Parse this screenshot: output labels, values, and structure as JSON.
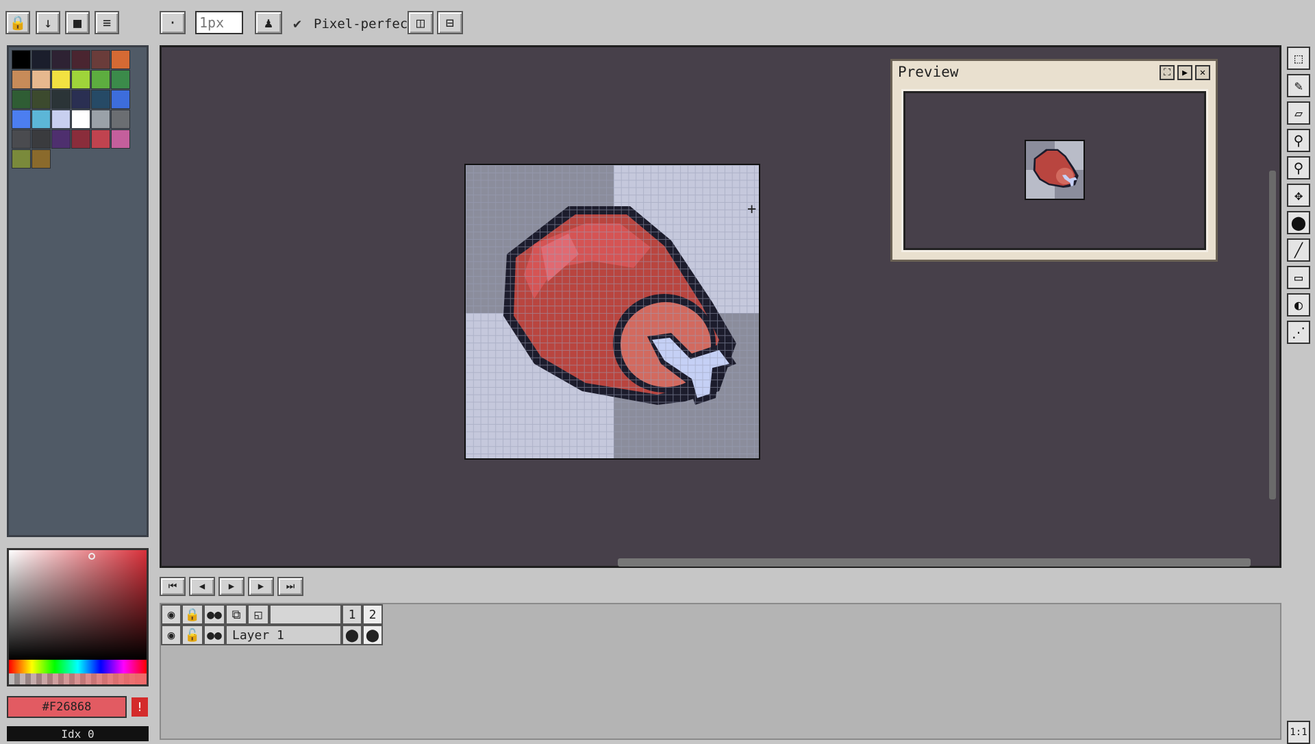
{
  "toolbar": {
    "brush_size": "1px",
    "pixel_perfect_label": "Pixel-perfect",
    "pixel_perfect_checked": true
  },
  "preview": {
    "title": "Preview"
  },
  "layers": {
    "frames": [
      "1",
      "2"
    ],
    "items": [
      {
        "name": "Layer 1"
      }
    ]
  },
  "color": {
    "hex": "#F26868",
    "current": "#f26868"
  },
  "bottom_label": "Idx 0",
  "zoom_button": "1:1",
  "palette_colors": [
    "#000000",
    "#1b1e2c",
    "#2e2233",
    "#4a2530",
    "#6a3c3a",
    "#d56a34",
    "#c78b59",
    "#e6b88e",
    "#f2e141",
    "#9fd43a",
    "#5dad3f",
    "#3b8b4a",
    "#2f5d34",
    "#3c4a2e",
    "#2b3437",
    "#2a2f52",
    "#264a66",
    "#3d6ddc",
    "#4c7ef0",
    "#5cb6d7",
    "#c8cfef",
    "#ffffff",
    "#9aa1a8",
    "#6b6e72",
    "#4a4b4f",
    "#3a3b3e",
    "#4e2f6e",
    "#8a2d3b",
    "#c0434f",
    "#c45f9c",
    "#7a8a3b",
    "#8a6a2c"
  ]
}
